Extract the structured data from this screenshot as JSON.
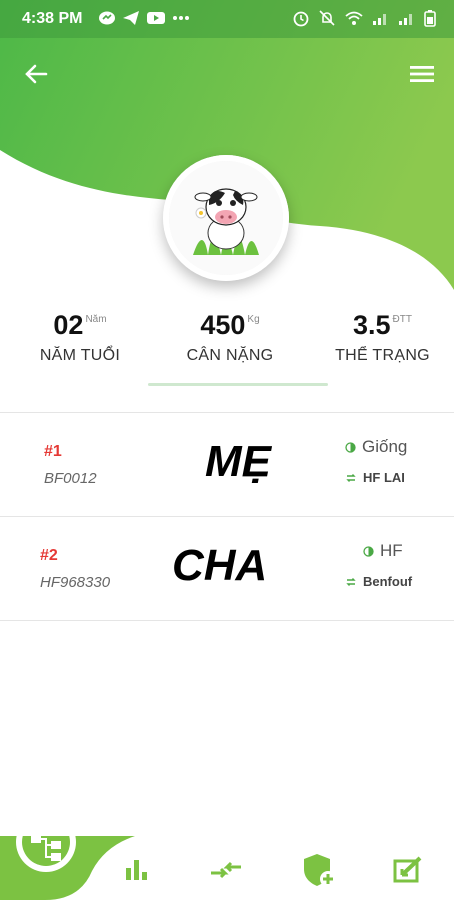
{
  "status_bar": {
    "time": "4:38 PM",
    "left_icons": [
      "messenger-icon",
      "telegram-icon",
      "youtube-icon",
      "more-dots-icon"
    ],
    "right_icons": [
      "alarm-icon",
      "mute-icon",
      "wifi-icon",
      "signal-icon",
      "signal-icon",
      "battery-icon"
    ]
  },
  "header": {
    "back_icon": "arrow-left-icon",
    "menu_icon": "hamburger-menu-icon",
    "avatar": "cow-avatar"
  },
  "stats": [
    {
      "value": "02",
      "unit": "Năm",
      "label": "NĂM TUỔI"
    },
    {
      "value": "450",
      "unit": "Kg",
      "label": "CÂN NẶNG"
    },
    {
      "value": "3.5",
      "unit": "ĐTT",
      "label": "THỂ TRẠNG"
    }
  ],
  "parents": [
    {
      "rank": "#1",
      "code": "BF0012",
      "role": "MẸ",
      "breed": "Giống",
      "origin": "HF LAI"
    },
    {
      "rank": "#2",
      "code": "HF968330",
      "role": "CHA",
      "breed": "HF",
      "origin": "Benfouf"
    }
  ],
  "bottom_nav": [
    {
      "icon": "family-tree-icon",
      "active": true
    },
    {
      "icon": "bar-chart-icon",
      "active": false
    },
    {
      "icon": "transfer-arrows-icon",
      "active": false
    },
    {
      "icon": "shield-add-icon",
      "active": false
    },
    {
      "icon": "edit-export-icon",
      "active": false
    }
  ],
  "colors": {
    "primary_green": "#5fbf4a",
    "light_green": "#8cc94e",
    "accent_red": "#e53935",
    "nav_icon_green": "#7cc242"
  }
}
